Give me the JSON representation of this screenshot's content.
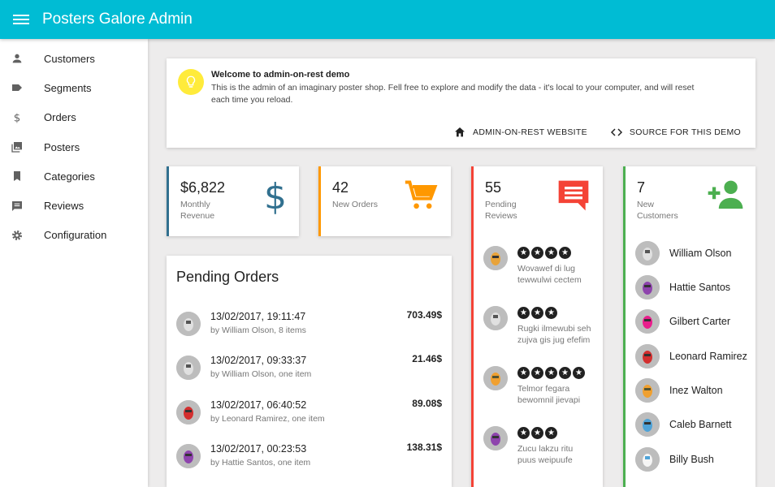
{
  "app": {
    "title": "Posters Galore Admin"
  },
  "sidebar": {
    "items": [
      {
        "label": "Customers",
        "icon": "person-icon"
      },
      {
        "label": "Segments",
        "icon": "label-icon"
      },
      {
        "label": "Orders",
        "icon": "dollar-icon"
      },
      {
        "label": "Posters",
        "icon": "image-collection-icon"
      },
      {
        "label": "Categories",
        "icon": "bookmark-icon"
      },
      {
        "label": "Reviews",
        "icon": "comment-icon"
      },
      {
        "label": "Configuration",
        "icon": "gear-icon"
      }
    ]
  },
  "welcome": {
    "title": "Welcome to admin-on-rest demo",
    "text": "This is the admin of an imaginary poster shop. Fell free to explore and modify the data - it's local to your computer, and will reset each time you reload.",
    "website_label": "ADMIN-ON-REST WEBSITE",
    "source_label": "SOURCE FOR THIS DEMO"
  },
  "stats": {
    "revenue": {
      "value": "$6,822",
      "caption1": "Monthly",
      "caption2": "Revenue",
      "color": "#31708f"
    },
    "orders": {
      "value": "42",
      "caption": "New Orders",
      "color": "#ff9800"
    },
    "reviews": {
      "value": "55",
      "caption1": "Pending",
      "caption2": "Reviews",
      "color": "#f44336"
    },
    "customers": {
      "value": "7",
      "caption1": "New",
      "caption2": "Customers",
      "color": "#4caf50"
    }
  },
  "pending_orders": {
    "title": "Pending Orders",
    "orders": [
      {
        "date": "13/02/2017, 19:11:47",
        "by": "by William Olson, 8 items",
        "amount": "703.49$"
      },
      {
        "date": "13/02/2017, 09:33:37",
        "by": "by William Olson, one item",
        "amount": "21.46$"
      },
      {
        "date": "13/02/2017, 06:40:52",
        "by": "by Leonard Ramirez, one item",
        "amount": "89.08$"
      },
      {
        "date": "13/02/2017, 00:23:53",
        "by": "by Hattie Santos, one item",
        "amount": "138.31$"
      }
    ]
  },
  "reviews": [
    {
      "stars": 4,
      "line1": "Wovawef di lug",
      "line2": "tewwulwi cectem"
    },
    {
      "stars": 3,
      "line1": "Rugki ilmewubi seh",
      "line2": "zujva gis jug efefim"
    },
    {
      "stars": 5,
      "line1": "Telmor fegara",
      "line2": "bewomnil jievapi"
    },
    {
      "stars": 3,
      "line1": "Zucu lakzu ritu",
      "line2": "puus weipuufe"
    }
  ],
  "customers": [
    {
      "name": "William Olson"
    },
    {
      "name": "Hattie Santos"
    },
    {
      "name": "Gilbert Carter"
    },
    {
      "name": "Leonard Ramirez"
    },
    {
      "name": "Inez Walton"
    },
    {
      "name": "Caleb Barnett"
    },
    {
      "name": "Billy Bush"
    }
  ]
}
